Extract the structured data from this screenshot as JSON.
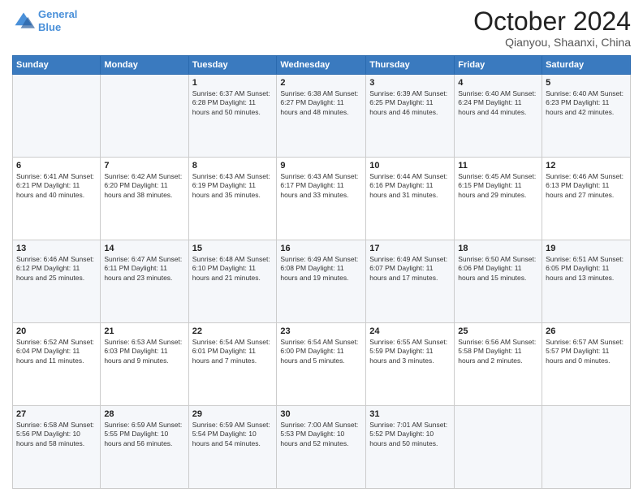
{
  "header": {
    "logo_line1": "General",
    "logo_line2": "Blue",
    "month": "October 2024",
    "location": "Qianyou, Shaanxi, China"
  },
  "weekdays": [
    "Sunday",
    "Monday",
    "Tuesday",
    "Wednesday",
    "Thursday",
    "Friday",
    "Saturday"
  ],
  "weeks": [
    [
      {
        "day": "",
        "content": ""
      },
      {
        "day": "",
        "content": ""
      },
      {
        "day": "1",
        "content": "Sunrise: 6:37 AM\nSunset: 6:28 PM\nDaylight: 11 hours and 50 minutes."
      },
      {
        "day": "2",
        "content": "Sunrise: 6:38 AM\nSunset: 6:27 PM\nDaylight: 11 hours and 48 minutes."
      },
      {
        "day": "3",
        "content": "Sunrise: 6:39 AM\nSunset: 6:25 PM\nDaylight: 11 hours and 46 minutes."
      },
      {
        "day": "4",
        "content": "Sunrise: 6:40 AM\nSunset: 6:24 PM\nDaylight: 11 hours and 44 minutes."
      },
      {
        "day": "5",
        "content": "Sunrise: 6:40 AM\nSunset: 6:23 PM\nDaylight: 11 hours and 42 minutes."
      }
    ],
    [
      {
        "day": "6",
        "content": "Sunrise: 6:41 AM\nSunset: 6:21 PM\nDaylight: 11 hours and 40 minutes."
      },
      {
        "day": "7",
        "content": "Sunrise: 6:42 AM\nSunset: 6:20 PM\nDaylight: 11 hours and 38 minutes."
      },
      {
        "day": "8",
        "content": "Sunrise: 6:43 AM\nSunset: 6:19 PM\nDaylight: 11 hours and 35 minutes."
      },
      {
        "day": "9",
        "content": "Sunrise: 6:43 AM\nSunset: 6:17 PM\nDaylight: 11 hours and 33 minutes."
      },
      {
        "day": "10",
        "content": "Sunrise: 6:44 AM\nSunset: 6:16 PM\nDaylight: 11 hours and 31 minutes."
      },
      {
        "day": "11",
        "content": "Sunrise: 6:45 AM\nSunset: 6:15 PM\nDaylight: 11 hours and 29 minutes."
      },
      {
        "day": "12",
        "content": "Sunrise: 6:46 AM\nSunset: 6:13 PM\nDaylight: 11 hours and 27 minutes."
      }
    ],
    [
      {
        "day": "13",
        "content": "Sunrise: 6:46 AM\nSunset: 6:12 PM\nDaylight: 11 hours and 25 minutes."
      },
      {
        "day": "14",
        "content": "Sunrise: 6:47 AM\nSunset: 6:11 PM\nDaylight: 11 hours and 23 minutes."
      },
      {
        "day": "15",
        "content": "Sunrise: 6:48 AM\nSunset: 6:10 PM\nDaylight: 11 hours and 21 minutes."
      },
      {
        "day": "16",
        "content": "Sunrise: 6:49 AM\nSunset: 6:08 PM\nDaylight: 11 hours and 19 minutes."
      },
      {
        "day": "17",
        "content": "Sunrise: 6:49 AM\nSunset: 6:07 PM\nDaylight: 11 hours and 17 minutes."
      },
      {
        "day": "18",
        "content": "Sunrise: 6:50 AM\nSunset: 6:06 PM\nDaylight: 11 hours and 15 minutes."
      },
      {
        "day": "19",
        "content": "Sunrise: 6:51 AM\nSunset: 6:05 PM\nDaylight: 11 hours and 13 minutes."
      }
    ],
    [
      {
        "day": "20",
        "content": "Sunrise: 6:52 AM\nSunset: 6:04 PM\nDaylight: 11 hours and 11 minutes."
      },
      {
        "day": "21",
        "content": "Sunrise: 6:53 AM\nSunset: 6:03 PM\nDaylight: 11 hours and 9 minutes."
      },
      {
        "day": "22",
        "content": "Sunrise: 6:54 AM\nSunset: 6:01 PM\nDaylight: 11 hours and 7 minutes."
      },
      {
        "day": "23",
        "content": "Sunrise: 6:54 AM\nSunset: 6:00 PM\nDaylight: 11 hours and 5 minutes."
      },
      {
        "day": "24",
        "content": "Sunrise: 6:55 AM\nSunset: 5:59 PM\nDaylight: 11 hours and 3 minutes."
      },
      {
        "day": "25",
        "content": "Sunrise: 6:56 AM\nSunset: 5:58 PM\nDaylight: 11 hours and 2 minutes."
      },
      {
        "day": "26",
        "content": "Sunrise: 6:57 AM\nSunset: 5:57 PM\nDaylight: 11 hours and 0 minutes."
      }
    ],
    [
      {
        "day": "27",
        "content": "Sunrise: 6:58 AM\nSunset: 5:56 PM\nDaylight: 10 hours and 58 minutes."
      },
      {
        "day": "28",
        "content": "Sunrise: 6:59 AM\nSunset: 5:55 PM\nDaylight: 10 hours and 56 minutes."
      },
      {
        "day": "29",
        "content": "Sunrise: 6:59 AM\nSunset: 5:54 PM\nDaylight: 10 hours and 54 minutes."
      },
      {
        "day": "30",
        "content": "Sunrise: 7:00 AM\nSunset: 5:53 PM\nDaylight: 10 hours and 52 minutes."
      },
      {
        "day": "31",
        "content": "Sunrise: 7:01 AM\nSunset: 5:52 PM\nDaylight: 10 hours and 50 minutes."
      },
      {
        "day": "",
        "content": ""
      },
      {
        "day": "",
        "content": ""
      }
    ]
  ]
}
